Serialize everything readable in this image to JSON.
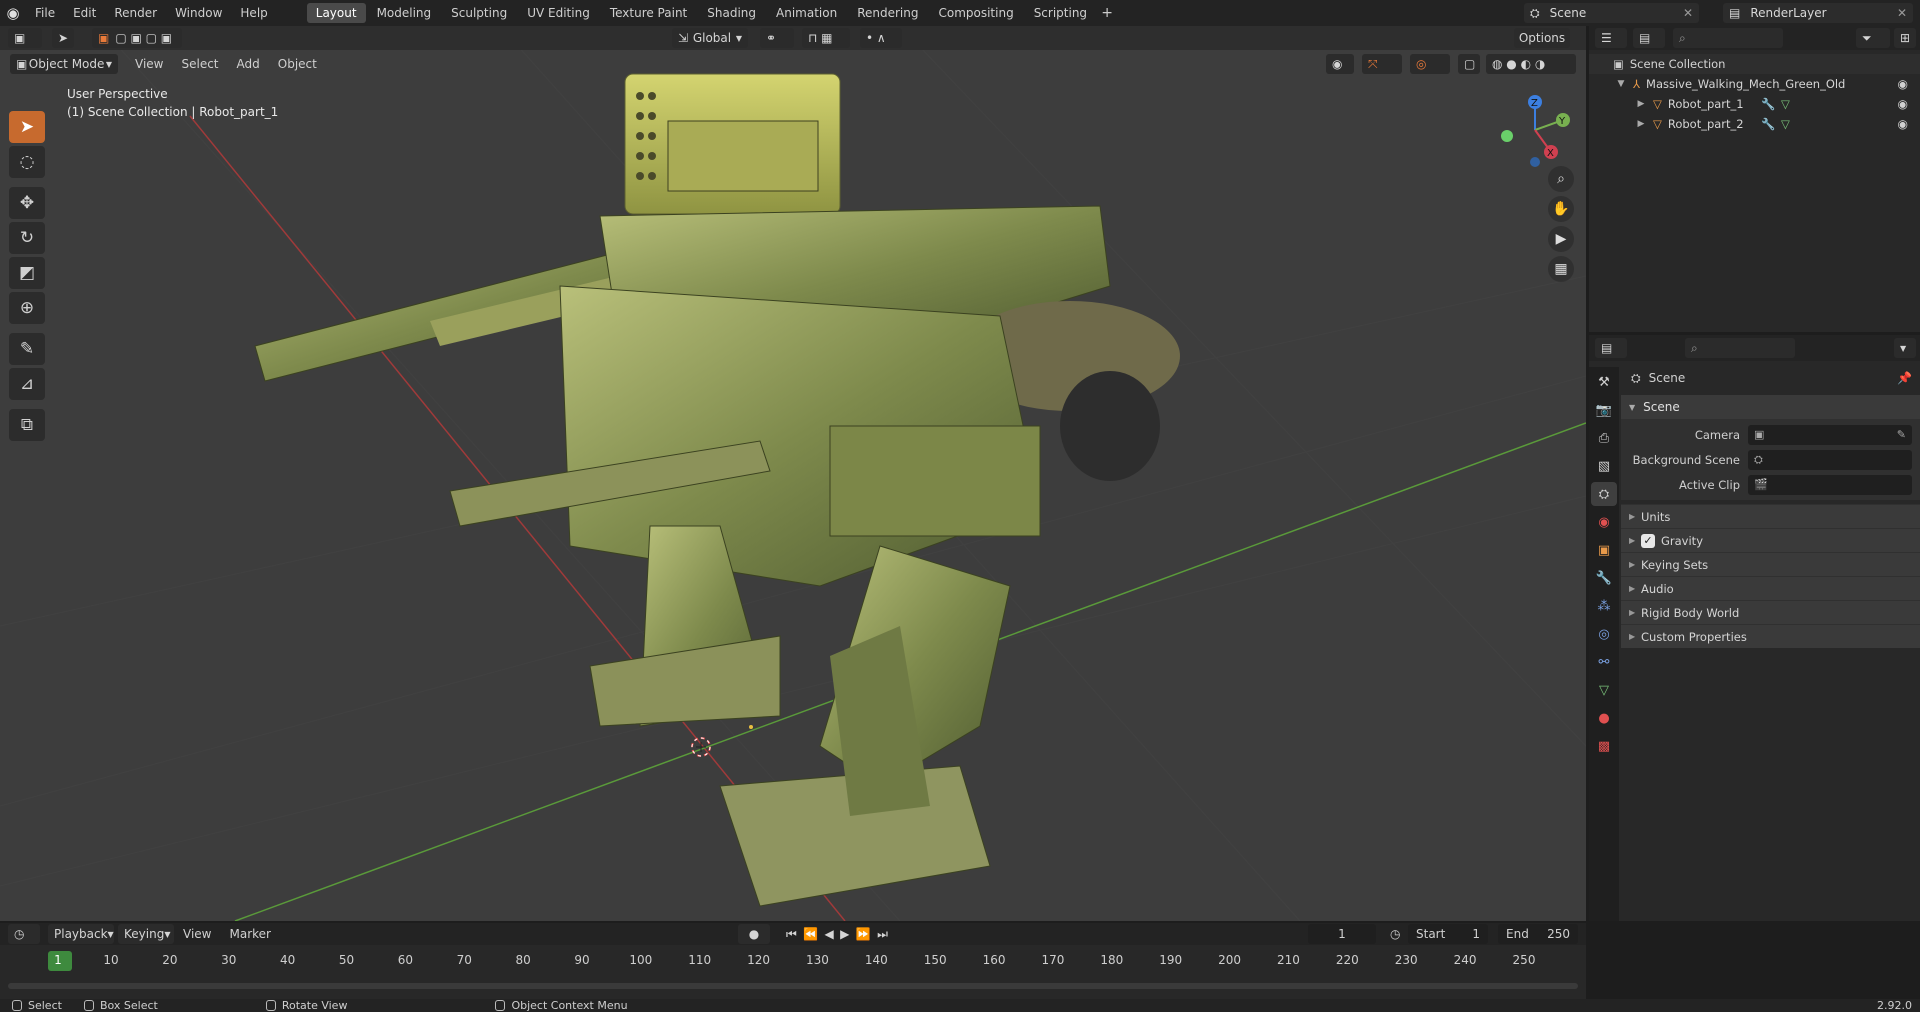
{
  "topbar": {
    "menus": [
      "File",
      "Edit",
      "Render",
      "Window",
      "Help"
    ],
    "workspace_tabs": [
      "Layout",
      "Modeling",
      "Sculpting",
      "UV Editing",
      "Texture Paint",
      "Shading",
      "Animation",
      "Rendering",
      "Compositing",
      "Scripting"
    ],
    "active_tab": "Layout",
    "scene_name": "Scene",
    "view_layer_name": "RenderLayer"
  },
  "viewport": {
    "mode": "Object Mode",
    "menus": [
      "View",
      "Select",
      "Add",
      "Object"
    ],
    "transform_orientation": "Global",
    "options_label": "Options",
    "perspective_label": "User Perspective",
    "collection_label": "(1) Scene Collection | Robot_part_1",
    "colors": {
      "x_axis": "#a03a3a",
      "y_axis": "#5a9a3a",
      "active_tool": "#c76a2e",
      "background": "#3d3d3d"
    }
  },
  "outliner": {
    "root": "Scene Collection",
    "items": [
      {
        "name": "Massive_Walking_Mech_Green_Old",
        "depth": 1
      },
      {
        "name": "Robot_part_1",
        "depth": 2
      },
      {
        "name": "Robot_part_2",
        "depth": 2
      }
    ]
  },
  "properties": {
    "context_title": "Scene",
    "panel_title": "Scene",
    "fields": [
      {
        "label": "Camera",
        "value": ""
      },
      {
        "label": "Background Scene",
        "value": ""
      },
      {
        "label": "Active Clip",
        "value": ""
      }
    ],
    "subpanels": [
      "Units",
      "Gravity",
      "Keying Sets",
      "Audio",
      "Rigid Body World",
      "Custom Properties"
    ],
    "gravity_checked": true
  },
  "timeline": {
    "menus": [
      "Playback",
      "Keying",
      "View",
      "Marker"
    ],
    "current_frame": "1",
    "start_label": "Start",
    "start_value": "1",
    "end_label": "End",
    "end_value": "250",
    "ruler_marks": [
      "1",
      "10",
      "20",
      "30",
      "40",
      "50",
      "60",
      "70",
      "80",
      "90",
      "100",
      "110",
      "120",
      "130",
      "140",
      "150",
      "160",
      "170",
      "180",
      "190",
      "200",
      "210",
      "220",
      "230",
      "240",
      "250"
    ]
  },
  "statusbar": {
    "select": "Select",
    "box_select": "Box Select",
    "rotate_view": "Rotate View",
    "context_menu": "Object Context Menu",
    "version": "2.92.0"
  }
}
